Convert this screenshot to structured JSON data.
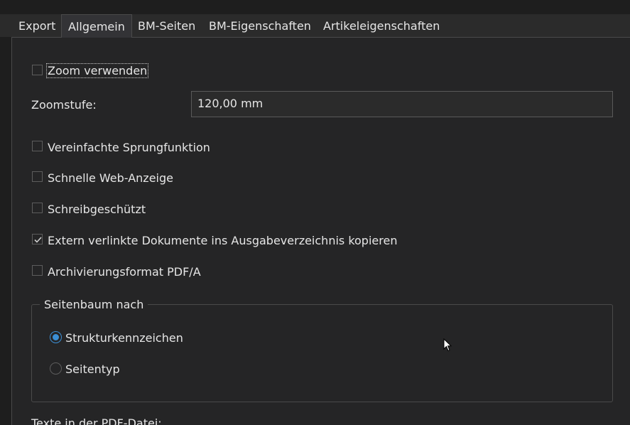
{
  "tabs": [
    {
      "label": "Export",
      "active": false
    },
    {
      "label": "Allgemein",
      "active": true
    },
    {
      "label": "BM-Seiten",
      "active": false
    },
    {
      "label": "BM-Eigenschaften",
      "active": false
    },
    {
      "label": "Artikeleigenschaften",
      "active": false
    }
  ],
  "general": {
    "zoom_label": "Zoom verwenden",
    "zoom_checked": false,
    "zoomstufe_label": "Zoomstufe:",
    "zoomstufe_value": "120,00 mm",
    "options": [
      {
        "label": "Vereinfachte Sprungfunktion",
        "checked": false
      },
      {
        "label": "Schnelle Web-Anzeige",
        "checked": false
      },
      {
        "label": "Schreibgeschützt",
        "checked": false
      },
      {
        "label": "Extern verlinkte Dokumente ins Ausgabeverzeichnis kopieren",
        "checked": true
      },
      {
        "label": "Archivierungsformat PDF/A",
        "checked": false
      }
    ],
    "seitenbaum": {
      "legend": "Seitenbaum nach",
      "radios": [
        {
          "label": "Strukturkennzeichen",
          "selected": true
        },
        {
          "label": "Seitentyp",
          "selected": false
        }
      ]
    },
    "texte_label": "Texte in der PDF-Datei:"
  },
  "colors": {
    "accent": "#3b8fd6",
    "background": "#252526",
    "text": "#e6e6e6"
  }
}
